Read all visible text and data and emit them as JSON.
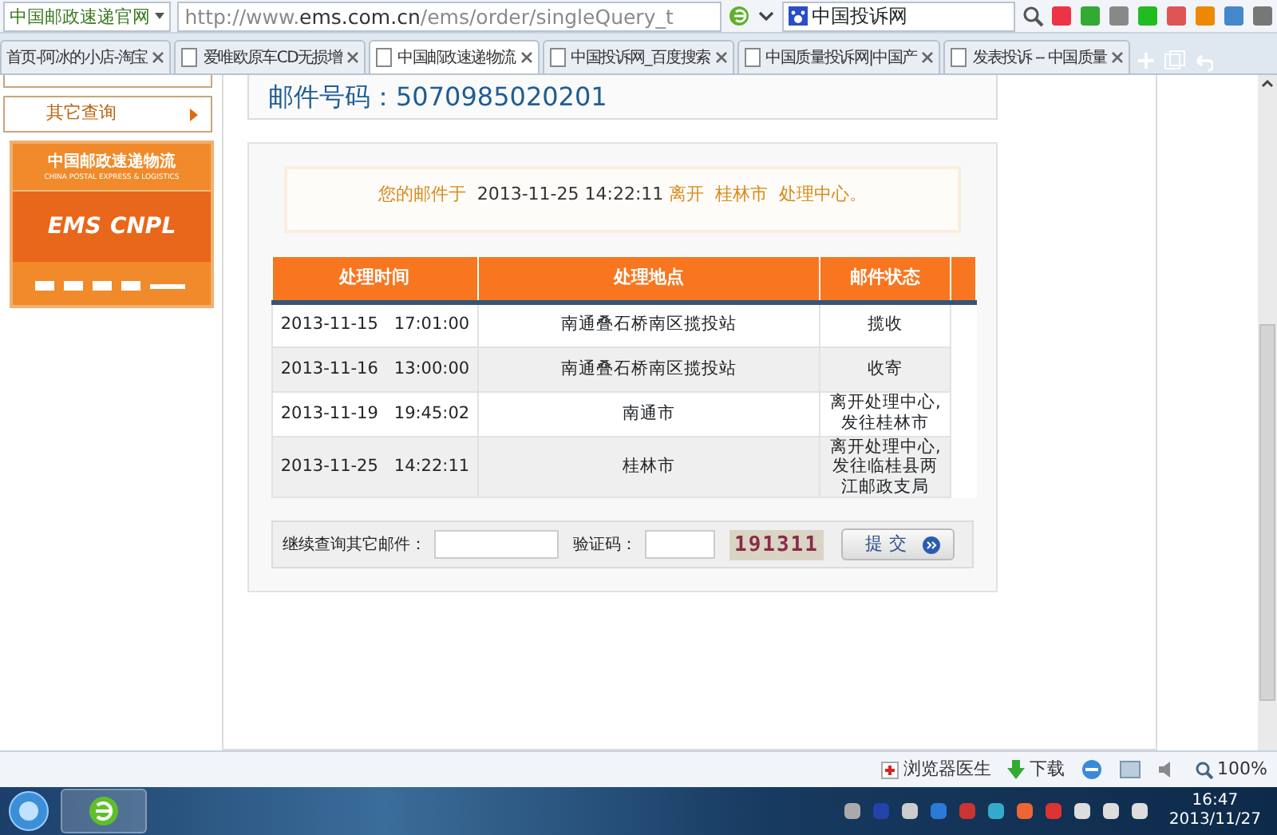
{
  "browser": {
    "site_menu": "中国邮政速递官网",
    "url_prefix": "http://www.",
    "url_domain": "ems.com.cn",
    "url_path": "/ems/order/singleQuery_t",
    "search_value": "中国投诉网",
    "tabs": [
      {
        "title": "首页-阿冰的小店-淘宝",
        "selected": false
      },
      {
        "title": "爱唯欧原车CD无损增",
        "selected": false
      },
      {
        "title": "中国邮政速递物流",
        "selected": true
      },
      {
        "title": "中国投诉网_百度搜索",
        "selected": false
      },
      {
        "title": "中国质量投诉网|中国产",
        "selected": false
      },
      {
        "title": "发表投诉 -- 中国质量",
        "selected": false
      }
    ]
  },
  "sidebar": {
    "items": [
      {
        "label": "其它查询"
      }
    ],
    "logo": {
      "name_cn": "中国邮政速递物流",
      "name_en": "CHINA POSTAL EXPRESS & LOGISTICS",
      "brand_left": "EMS",
      "brand_right": "CNPL"
    }
  },
  "mail_number": "邮件号码：5070985020201",
  "notice": {
    "prefix": "您的邮件于",
    "time": "2013-11-25 14:22:11",
    "suffix": "离开  桂林市  处理中心。"
  },
  "table": {
    "columns": [
      "处理时间",
      "处理地点",
      "邮件状态"
    ],
    "rows": [
      {
        "cells": [
          "2013-11-15   17:01:00",
          "南通叠石桥南区揽投站",
          "揽收"
        ]
      },
      {
        "cells": [
          "2013-11-16   13:00:00",
          "南通叠石桥南区揽投站",
          "收寄"
        ]
      },
      {
        "cells": [
          "2013-11-19   19:45:02",
          "南通市",
          "离开处理中心,发往桂林市"
        ]
      },
      {
        "cells": [
          "2013-11-25   14:22:11",
          "桂林市",
          "离开处理中心,发往临桂县两江邮政支局"
        ]
      }
    ]
  },
  "query": {
    "label": "继续查询其它邮件：",
    "captcha_label": "验证码：",
    "captcha_code": "191311",
    "submit": "提交"
  },
  "status_bar": {
    "items": [
      "浏览器医生",
      "下载"
    ],
    "zoom": "100%"
  },
  "taskbar": {
    "time": "16:47",
    "date": "2013/11/27"
  }
}
